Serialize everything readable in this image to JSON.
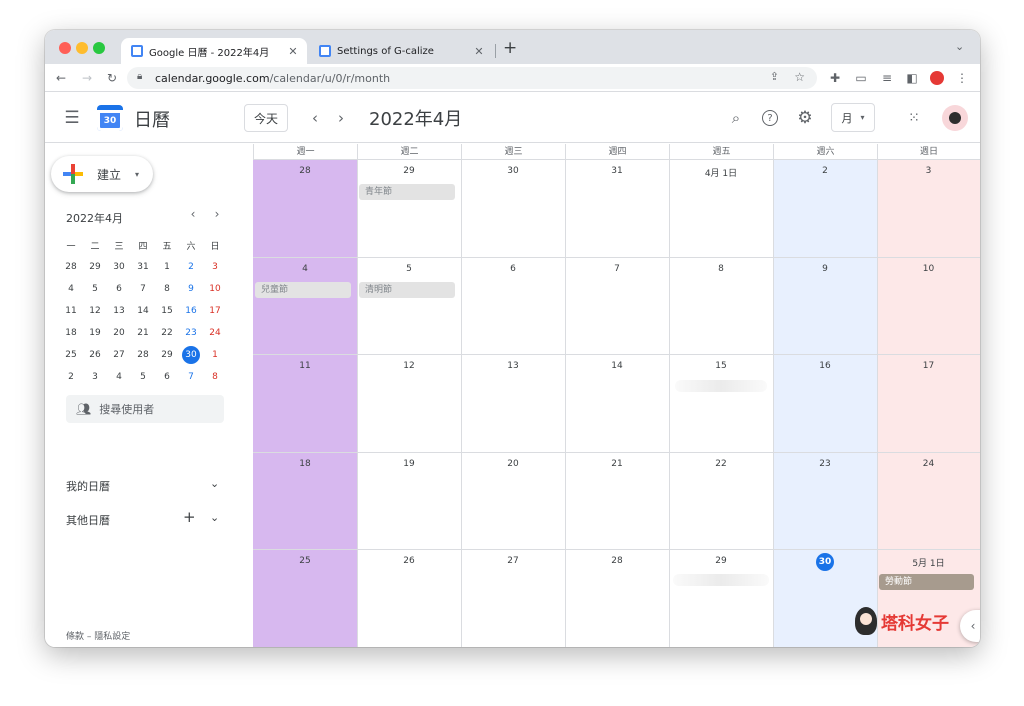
{
  "browser": {
    "tabs": [
      {
        "title": "Google 日曆 - 2022年4月",
        "active": true
      },
      {
        "title": "Settings of G-calize",
        "active": false
      }
    ],
    "new_tab": "+",
    "url_host": "calendar.google.com",
    "url_path": "/calendar/u/0/r/month"
  },
  "header": {
    "app_name": "日曆",
    "logo_text": "30",
    "today_button": "今天",
    "month_title": "2022年4月",
    "view_selector": "月"
  },
  "sidebar": {
    "create_button": "建立",
    "mini_calendar": {
      "title": "2022年4月",
      "weekdays": [
        "一",
        "二",
        "三",
        "四",
        "五",
        "六",
        "日"
      ],
      "weeks": [
        [
          "28",
          "29",
          "30",
          "31",
          "1",
          "2",
          "3"
        ],
        [
          "4",
          "5",
          "6",
          "7",
          "8",
          "9",
          "10"
        ],
        [
          "11",
          "12",
          "13",
          "14",
          "15",
          "16",
          "17"
        ],
        [
          "18",
          "19",
          "20",
          "21",
          "22",
          "23",
          "24"
        ],
        [
          "25",
          "26",
          "27",
          "28",
          "29",
          "30",
          "1"
        ],
        [
          "2",
          "3",
          "4",
          "5",
          "6",
          "7",
          "8"
        ]
      ],
      "selected_day": "30"
    },
    "search_users_placeholder": "搜尋使用者",
    "my_calendars": "我的日曆",
    "other_calendars": "其他日曆",
    "footer": "條款 – 隱私設定"
  },
  "calendar": {
    "weekday_headers": [
      "週一",
      "週二",
      "週三",
      "週四",
      "週五",
      "週六",
      "週日"
    ],
    "column_colors": {
      "mon": "#d7b8ef",
      "sat": "#e8f0fe",
      "sun": "#fde8e8"
    },
    "weeks": [
      [
        "28",
        "29",
        "30",
        "31",
        "4月 1日",
        "2",
        "3"
      ],
      [
        "4",
        "5",
        "6",
        "7",
        "8",
        "9",
        "10"
      ],
      [
        "11",
        "12",
        "13",
        "14",
        "15",
        "16",
        "17"
      ],
      [
        "18",
        "19",
        "20",
        "21",
        "22",
        "23",
        "24"
      ],
      [
        "25",
        "26",
        "27",
        "28",
        "29",
        "30",
        "5月 1日"
      ]
    ],
    "today": "30",
    "events": {
      "youth_day": "青年節",
      "childrens_day": "兒童節",
      "tomb_sweeping": "清明節",
      "labor_day": "勞動節"
    }
  },
  "watermark": "塔科女子"
}
